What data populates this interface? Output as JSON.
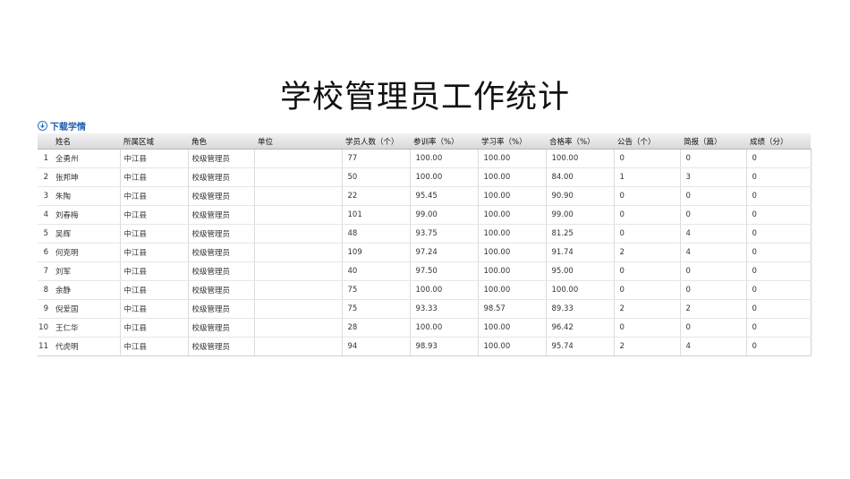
{
  "page": {
    "title": "学校管理员工作统计"
  },
  "toolbar": {
    "download_label": "下载学情",
    "icon": "download-icon"
  },
  "table": {
    "columns": [
      "",
      "姓名",
      "所属区域",
      "角色",
      "单位",
      "学员人数（个）",
      "参训率（%）",
      "学习率（%）",
      "合格率（%）",
      "公告（个）",
      "简报（篇）",
      "成绩（分）"
    ],
    "rows": [
      [
        "1",
        "全勇州",
        "中江县",
        "校级管理员",
        "",
        "77",
        "100.00",
        "100.00",
        "100.00",
        "0",
        "0",
        "0"
      ],
      [
        "2",
        "张邦坤",
        "中江县",
        "校级管理员",
        "",
        "50",
        "100.00",
        "100.00",
        "84.00",
        "1",
        "3",
        "0"
      ],
      [
        "3",
        "朱陶",
        "中江县",
        "校级管理员",
        "",
        "22",
        "95.45",
        "100.00",
        "90.90",
        "0",
        "0",
        "0"
      ],
      [
        "4",
        "刘春梅",
        "中江县",
        "校级管理员",
        "",
        "101",
        "99.00",
        "100.00",
        "99.00",
        "0",
        "0",
        "0"
      ],
      [
        "5",
        "吴辉",
        "中江县",
        "校级管理员",
        "",
        "48",
        "93.75",
        "100.00",
        "81.25",
        "0",
        "4",
        "0"
      ],
      [
        "6",
        "何克明",
        "中江县",
        "校级管理员",
        "",
        "109",
        "97.24",
        "100.00",
        "91.74",
        "2",
        "4",
        "0"
      ],
      [
        "7",
        "刘军",
        "中江县",
        "校级管理员",
        "",
        "40",
        "97.50",
        "100.00",
        "95.00",
        "0",
        "0",
        "0"
      ],
      [
        "8",
        "余静",
        "中江县",
        "校级管理员",
        "",
        "75",
        "100.00",
        "100.00",
        "100.00",
        "0",
        "0",
        "0"
      ],
      [
        "9",
        "倪爱国",
        "中江县",
        "校级管理员",
        "",
        "75",
        "93.33",
        "98.57",
        "89.33",
        "2",
        "2",
        "0"
      ],
      [
        "10",
        "王仁华",
        "中江县",
        "校级管理员",
        "",
        "28",
        "100.00",
        "100.00",
        "96.42",
        "0",
        "0",
        "0"
      ],
      [
        "11",
        "代虎明",
        "中江县",
        "校级管理员",
        "",
        "94",
        "98.93",
        "100.00",
        "95.74",
        "2",
        "4",
        "0"
      ]
    ]
  }
}
